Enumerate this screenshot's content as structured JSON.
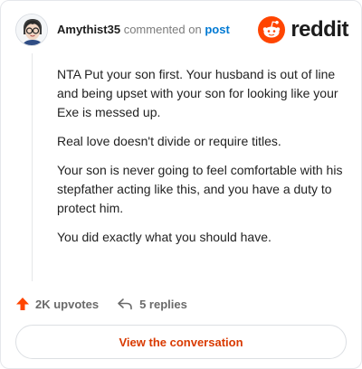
{
  "header": {
    "author": "Amythist35",
    "commented_on": "commented on",
    "post_link": "post",
    "brand": "reddit"
  },
  "comment": {
    "paragraphs": [
      "NTA Put your son first. Your husband is out of line and being upset with your son for looking like your Exe is messed up.",
      "Real love doesn't divide or require titles.",
      "Your son is never going to feel comfortable with his stepfather acting like this, and you have a duty to protect him.",
      "You did exactly what you should have."
    ]
  },
  "actions": {
    "upvotes": "2K upvotes",
    "replies": "5 replies"
  },
  "footer": {
    "view_button": "View the conversation"
  },
  "colors": {
    "brand": "#ff4500",
    "link": "#0079d3",
    "button_text": "#d93a00"
  },
  "icons": [
    "avatar",
    "reddit-logo-icon",
    "upvote-icon",
    "reply-icon"
  ]
}
